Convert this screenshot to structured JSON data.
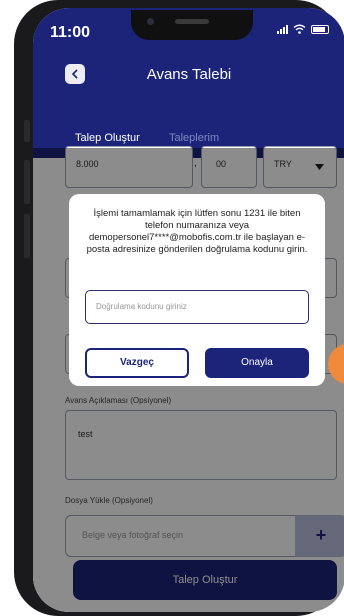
{
  "status": {
    "time": "11:00"
  },
  "header": {
    "title": "Avans Talebi",
    "back_icon": "chevron-left-icon"
  },
  "tabs": [
    {
      "label": "Talep Oluştur",
      "active": true
    },
    {
      "label": "Taleplerim",
      "active": false
    }
  ],
  "form": {
    "amount": "8.000",
    "amount_separator": ",",
    "decimals": "00",
    "currency": "TRY",
    "description_label": "Avans Açıklaması (Opsiyonel)",
    "description_value": "test",
    "upload_label": "Dosya Yükle (Opsiyonel)",
    "upload_placeholder": "Belge veya fotoğraf seçin",
    "upload_button": "+",
    "submit_label": "Talep Oluştur"
  },
  "modal": {
    "message": "İşlemi tamamlamak için lütfen sonu 1231 ile biten telefon numaranıza veya demopersonel7****@mobofis.com.tr ile başlayan e-posta adresinize gönderilen doğrulama kodunu girin.",
    "input_placeholder": "Doğrulama kodunu giriniz",
    "cancel_label": "Vazgeç",
    "confirm_label": "Onayla"
  },
  "colors": {
    "brand": "#1b2478",
    "accent": "#f08a3a"
  }
}
